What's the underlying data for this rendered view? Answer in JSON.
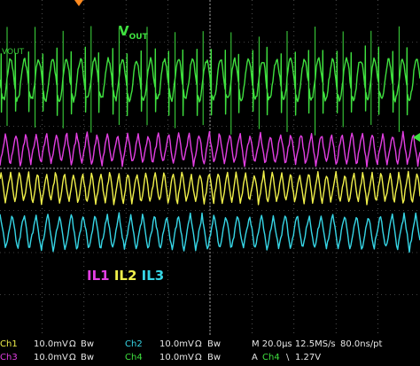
{
  "labels": {
    "vout": "V",
    "vout_sub": "OUT",
    "vout_marker": "VOUT",
    "il1": "IL1",
    "il2": "IL2",
    "il3": "IL3"
  },
  "status_bar": {
    "ch1_name": "Ch1",
    "ch1_scale": "10.0mV",
    "ch1_coupling": "Ω",
    "ch1_bw": "Bw",
    "ch2_name": "Ch2",
    "ch2_scale": "10.0mV",
    "ch2_coupling": "Ω",
    "ch2_bw": "Bw",
    "ch3_name": "Ch3",
    "ch3_scale": "10.0mV",
    "ch3_coupling": "Ω",
    "ch3_bw": "Bw",
    "ch4_name": "Ch4",
    "ch4_scale": "10.0mV",
    "ch4_coupling": "Ω",
    "ch4_bw": "Bw",
    "timebase": "M 20.0µs 12.5MS/s",
    "record": "80.0ns/pt",
    "trigger_mode": "A",
    "trigger_source": "Ch4",
    "trigger_slope": "\\",
    "trigger_level": "1.27V"
  },
  "colors": {
    "vout": "#3fe03f",
    "il1": "#e23fe2",
    "il2": "#f0f04a",
    "il3": "#36d6e6",
    "grid": "#808080",
    "trigger_marker": "#ff8a1f",
    "ch1_label": "#f0f04a",
    "ch2_label": "#36d6e6",
    "ch3_label": "#e23fe2",
    "ch4_label": "#3fe03f"
  }
}
